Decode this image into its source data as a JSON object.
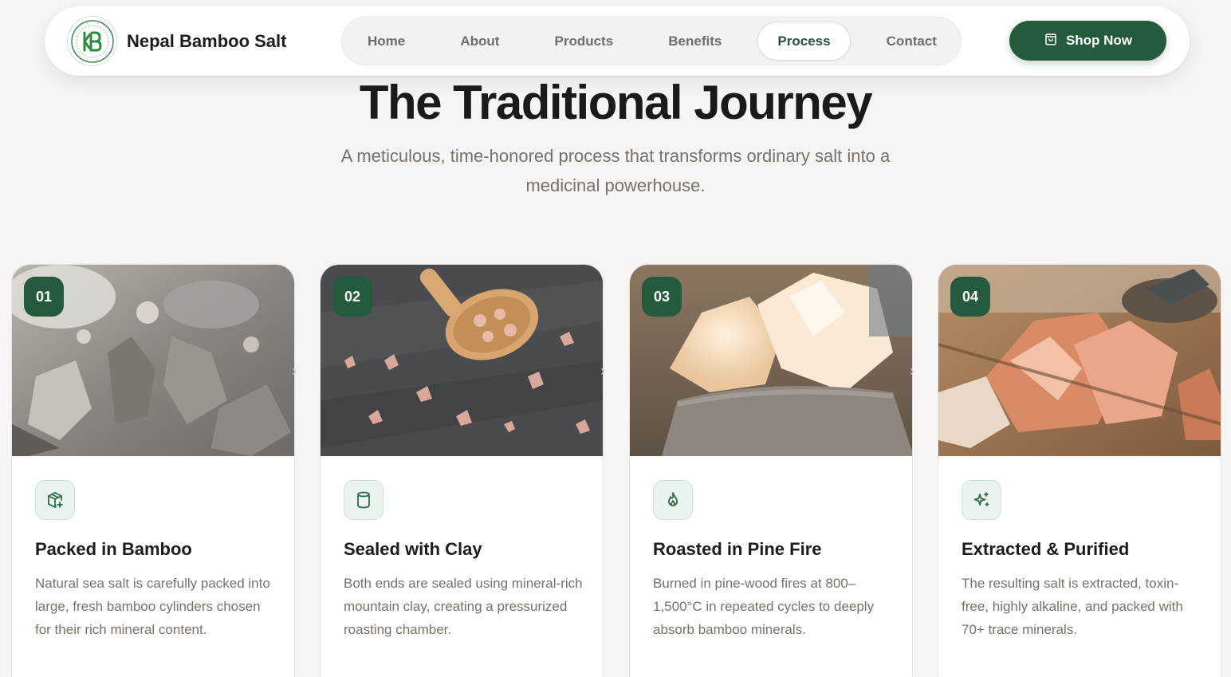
{
  "brand": {
    "name": "Nepal Bamboo Salt"
  },
  "nav": {
    "items": [
      {
        "label": "Home",
        "active": false
      },
      {
        "label": "About",
        "active": false
      },
      {
        "label": "Products",
        "active": false
      },
      {
        "label": "Benefits",
        "active": false
      },
      {
        "label": "Process",
        "active": true
      },
      {
        "label": "Contact",
        "active": false
      }
    ]
  },
  "cta": {
    "label": "Shop Now",
    "icon": "shopping-bag-icon"
  },
  "section": {
    "title": "The Traditional Journey",
    "subtitle": "A meticulous, time-honored process that transforms ordinary salt into a medicinal powerhouse."
  },
  "steps": [
    {
      "number": "01",
      "icon": "package-plus-icon",
      "title": "Packed in Bamboo",
      "text": "Natural sea salt is carefully packed into large, fresh bamboo cylinders chosen for their rich mineral content."
    },
    {
      "number": "02",
      "icon": "cylinder-icon",
      "title": "Sealed with Clay",
      "text": "Both ends are sealed using mineral-rich mountain clay, creating a pressurized roasting chamber."
    },
    {
      "number": "03",
      "icon": "flame-icon",
      "title": "Roasted in Pine Fire",
      "text": "Burned in pine-wood fires at 800–1,500°C in repeated cycles to deeply absorb bamboo minerals."
    },
    {
      "number": "04",
      "icon": "sparkles-icon",
      "title": "Extracted & Purified",
      "text": "The resulting salt is extracted, toxin-free, highly alkaline, and packed with 70+ trace minerals."
    }
  ],
  "colors": {
    "brand_green": "#235b3c",
    "page_bg": "#f6f5f3",
    "muted_text": "#7a7068"
  }
}
